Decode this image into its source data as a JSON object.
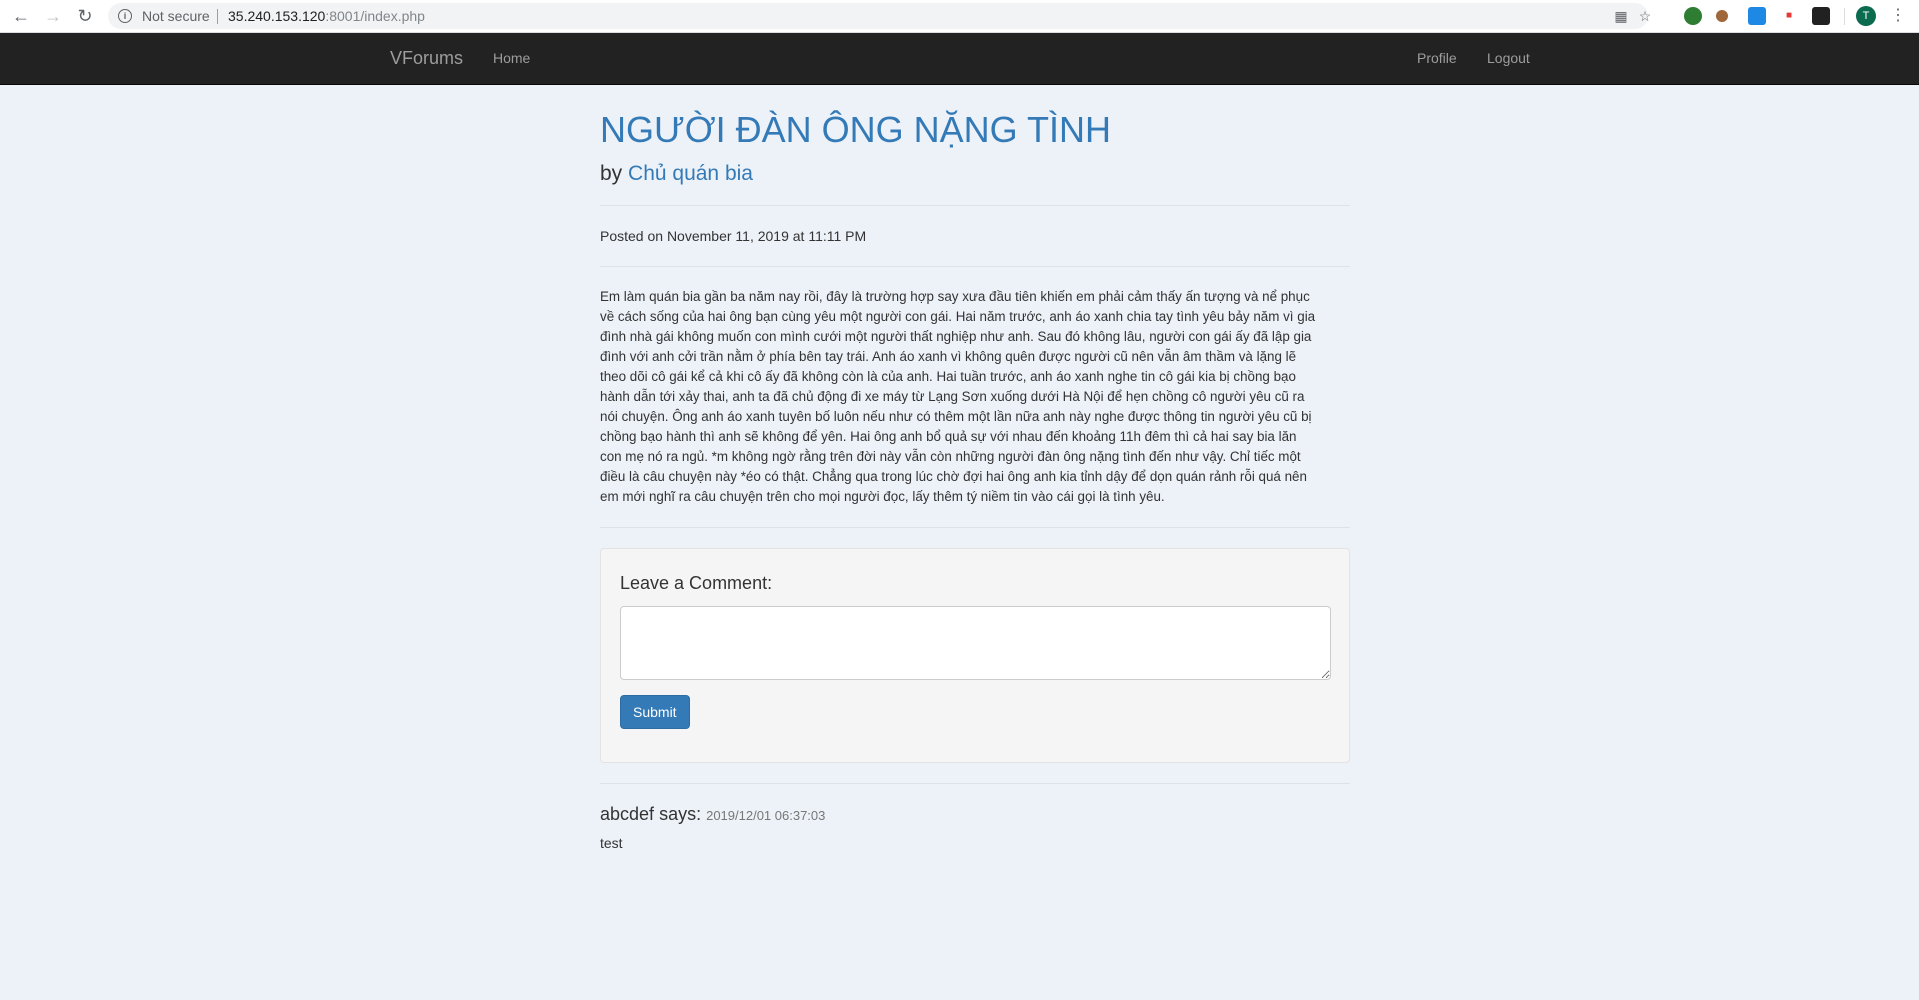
{
  "browser": {
    "not_secure_label": "Not secure",
    "url_host": "35.240.153.120",
    "url_rest": ":8001/index.php",
    "avatar_letter": "T"
  },
  "navbar": {
    "brand": "VForums",
    "home_label": "Home",
    "profile_label": "Profile",
    "logout_label": "Logout"
  },
  "post": {
    "title": "NGƯỜI ĐÀN ÔNG NẶNG TÌNH",
    "by_prefix": "by",
    "author": "Chủ quán bia",
    "posted_on": "Posted on November 11, 2019 at 11:11 PM",
    "body_lines": [
      "Em làm quán bia gần ba năm nay rồi, đây là trường hợp say xưa đầu tiên khiến em phải cảm thấy ấn tượng và nể phục",
      "về cách sống của hai ông bạn cùng yêu một người con gái. Hai năm trước, anh áo xanh chia tay tình yêu bảy năm vì gia",
      "đình nhà gái không muốn con mình cưới một người thất nghiệp như anh. Sau đó không lâu, người con gái ấy đã lập gia",
      "đình với anh cởi trần nằm ở phía bên tay trái. Anh áo xanh vì không quên được người cũ nên vẫn âm thầm và lặng lẽ",
      "theo dõi cô gái kể cả khi cô ấy đã không còn là của anh. Hai tuần trước, anh áo xanh nghe tin cô gái kia bị chồng bạo",
      "hành dẫn tới xảy thai, anh ta đã chủ động đi xe máy từ Lạng Sơn xuống dưới Hà Nội để hẹn chồng cô người yêu cũ ra",
      "nói chuyện. Ông anh áo xanh tuyên bố luôn nếu như có thêm một lần nữa anh này nghe được thông tin người yêu cũ bị",
      "chồng bạo hành thì anh sẽ không để yên. Hai ông anh bổ quả sự với nhau đến khoảng 11h đêm thì cả hai say bia lăn",
      "con mẹ nó ra ngủ. *m không ngờ rằng trên đời này vẫn còn những người đàn ông nặng tình đến như vậy. Chỉ tiếc một",
      "điều là câu chuyện này *éo có thật. Chẳng qua trong lúc chờ đợi hai ông anh kia tỉnh dậy để dọn quán rảnh rỗi quá nên",
      "em mới nghĩ ra câu chuyện trên cho mọi người đọc, lấy thêm tý niềm tin vào cái gọi là tình yêu."
    ]
  },
  "comment_form": {
    "heading": "Leave a Comment:",
    "textarea_value": "",
    "submit_label": "Submit"
  },
  "comments": [
    {
      "author": "abcdef",
      "says": "says:",
      "timestamp": "2019/12/01 06:37:03",
      "text": "test"
    }
  ],
  "colors": {
    "link": "#337ab7",
    "navbar": "#222222",
    "page_bg": "#edf1f8"
  }
}
